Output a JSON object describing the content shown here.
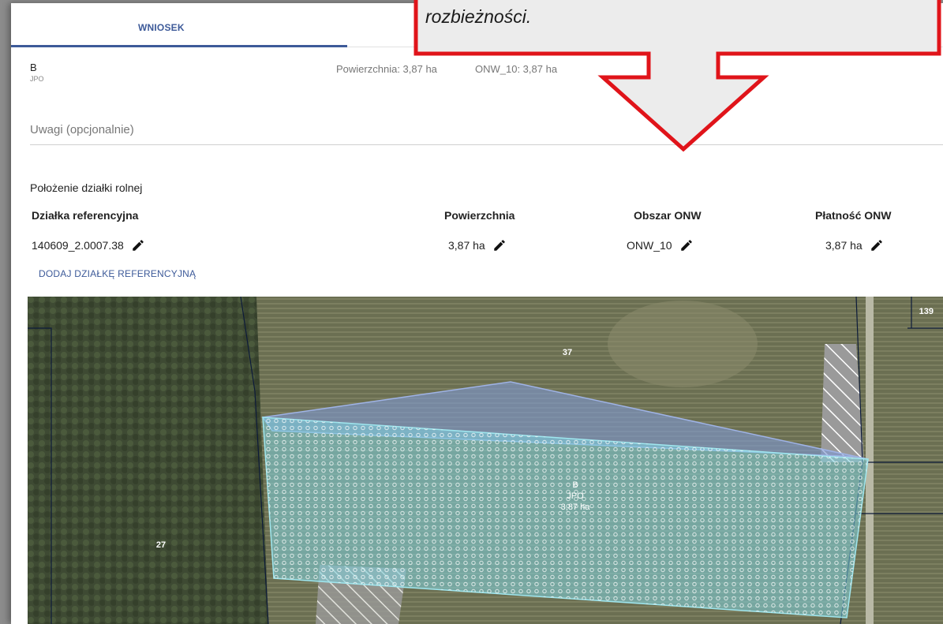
{
  "tabs": [
    {
      "label": "WNIOSEK",
      "active": true
    }
  ],
  "header": {
    "parcel_name": "B",
    "parcel_type": "JPO",
    "area_text": "Powierzchnia: 3,87 ha",
    "onw_text": "ONW_10: 3,87 ha"
  },
  "remarks": {
    "placeholder": "Uwagi (opcjonalnie)"
  },
  "location": {
    "title": "Położenie działki rolnej",
    "columns": {
      "ref_parcel": "Działka referencyjna",
      "area": "Powierzchnia",
      "onw_area": "Obszar ONW",
      "onw_payment": "Płatność ONW"
    },
    "rows": [
      {
        "ref_parcel": "140609_2.0007.38",
        "area": "3,87 ha",
        "onw_area": "ONW_10",
        "onw_payment": "3,87 ha"
      }
    ],
    "add_link": "DODAJ DZIAŁKĘ REFERENCYJNĄ"
  },
  "map": {
    "labels": {
      "parcel_37": "37",
      "parcel_27": "27",
      "parcel_139": "139",
      "field_name": "B",
      "field_type": "JPO",
      "field_area": "3,87 ha"
    }
  },
  "callout": {
    "text": "rozbieżności."
  },
  "colors": {
    "accent": "#3d5a99",
    "callout_border": "#e0141a",
    "field_fill": "#7fd3e0",
    "ref_parcel_fill": "#7f9ad6"
  }
}
